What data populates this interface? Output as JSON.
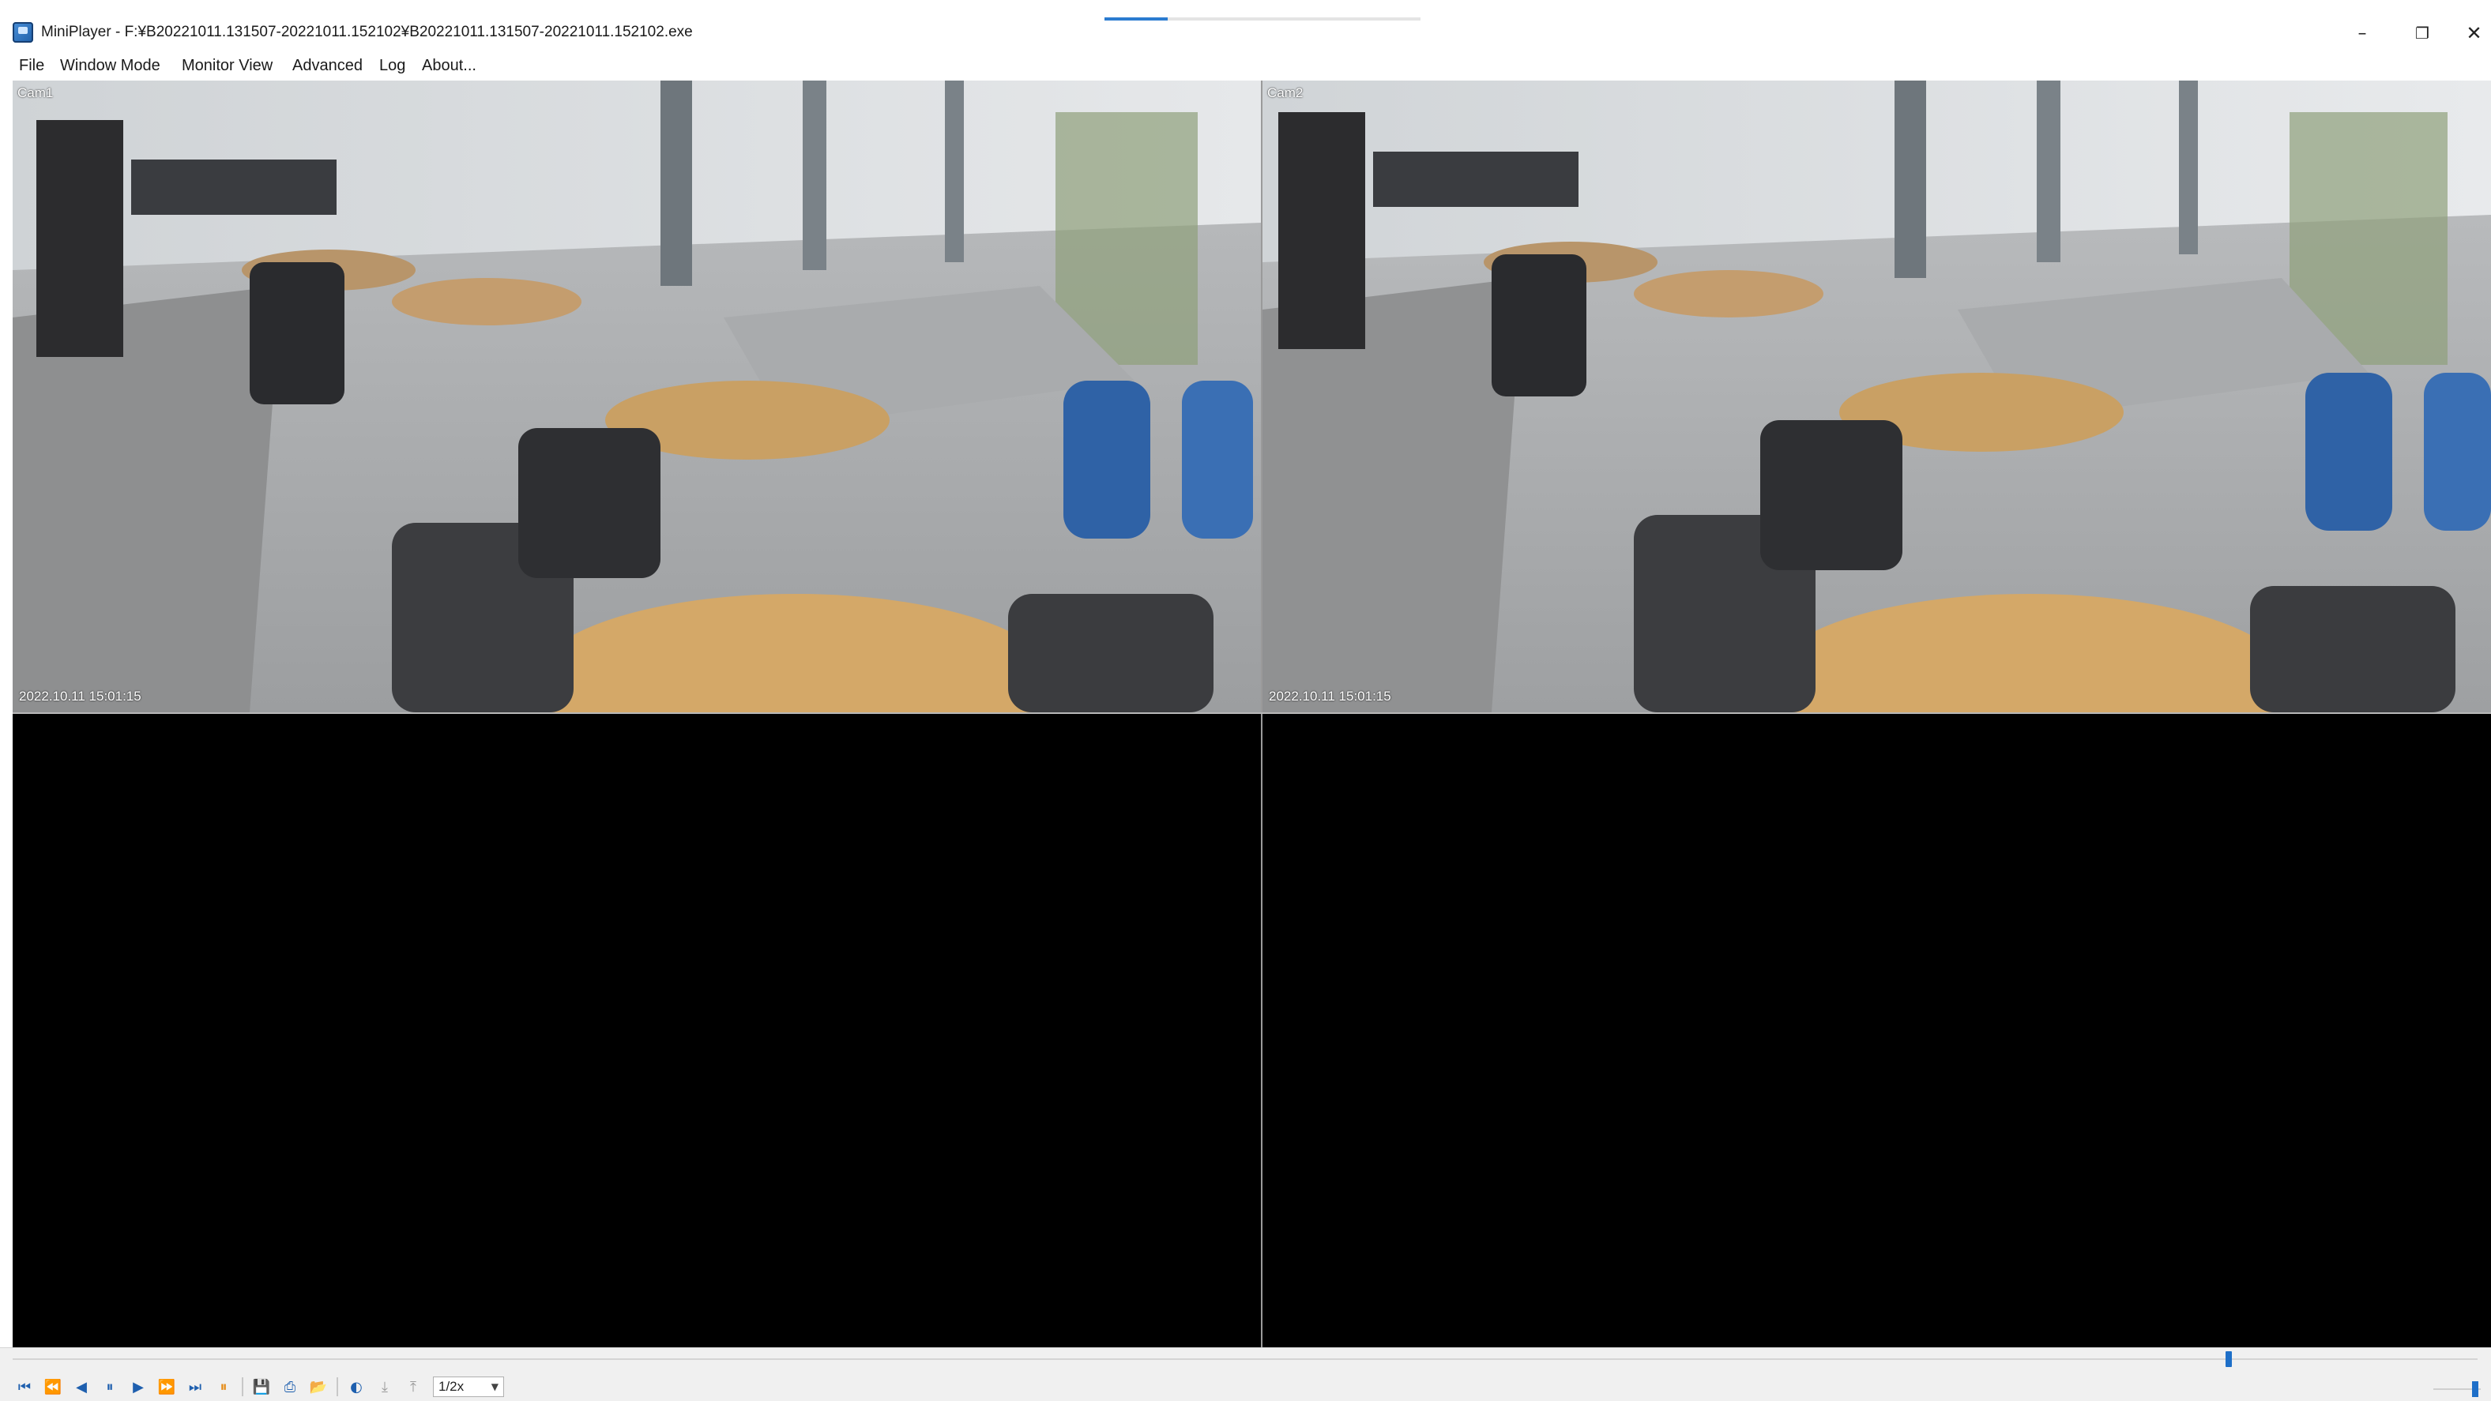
{
  "window": {
    "title": "MiniPlayer - F:¥B20221011.131507-20221011.152102¥B20221011.131507-20221011.152102.exe",
    "minimize": "–",
    "maximize": "❐",
    "close": "✕"
  },
  "menu": [
    {
      "label": "File"
    },
    {
      "label": "Window Mode"
    },
    {
      "label": "Monitor View"
    },
    {
      "label": "Advanced"
    },
    {
      "label": "Log"
    },
    {
      "label": "About..."
    }
  ],
  "cameras": [
    {
      "label": "Cam1",
      "timestamp": "2022.10.11 15:01:15",
      "state": "playing"
    },
    {
      "label": "Cam2",
      "timestamp": "2022.10.11 15:01:15",
      "state": "playing",
      "selected": true
    },
    {
      "label": "",
      "state": "empty"
    },
    {
      "label": "",
      "state": "empty"
    }
  ],
  "timeline": {
    "position_fraction": 0.9
  },
  "volume": {
    "level_fraction": 0.95
  },
  "controls": {
    "speed_value": "1/2x",
    "buttons": [
      {
        "name": "skip-start",
        "glyph": "⏮"
      },
      {
        "name": "fast-rewind",
        "glyph": "⏪"
      },
      {
        "name": "step-back",
        "glyph": "◀"
      },
      {
        "name": "pause",
        "glyph": "⏸"
      },
      {
        "name": "play",
        "glyph": "▶"
      },
      {
        "name": "fast-forward",
        "glyph": "⏩"
      },
      {
        "name": "skip-end",
        "glyph": "⏭"
      },
      {
        "name": "stop-record",
        "glyph": "⏸"
      },
      {
        "name": "save",
        "glyph": "💾"
      },
      {
        "name": "print",
        "glyph": "⎙"
      },
      {
        "name": "open-folder",
        "glyph": "📂"
      },
      {
        "name": "audio",
        "glyph": "◐"
      },
      {
        "name": "mark-in",
        "glyph": "⤓"
      },
      {
        "name": "mark-out",
        "glyph": "⤒"
      }
    ]
  },
  "colors": {
    "accent": "#1e6fc8",
    "record": "#e58a14",
    "video_background": "#000000"
  }
}
